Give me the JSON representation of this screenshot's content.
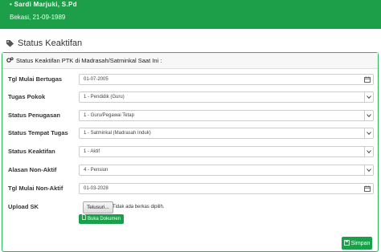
{
  "banner": {
    "name_text": "• Sardi Marjuki, S.Pd",
    "dob_text": "Bekasi, 21-09-1989"
  },
  "page": {
    "section_title": "Status Keaktifan",
    "panel_title": "Status Keaktifan PTK di Madrasah/Satminkal Saat Ini :"
  },
  "form": {
    "tgl_mulai_bertugas": {
      "label": "Tgl Mulai Bertugas",
      "value": "01-07-2005"
    },
    "tugas_pokok": {
      "label": "Tugas Pokok",
      "value": "1 - Pendidik (Guru)"
    },
    "status_penugasan": {
      "label": "Status Penugasan",
      "value": "1 - Guru/Pegawai Tetap"
    },
    "status_tempat_tugas": {
      "label": "Status Tempat Tugas",
      "value": "1 - Satminkal (Madrasah Induk)"
    },
    "status_keaktifan": {
      "label": "Status Keaktifan",
      "value": "1 - Aktif"
    },
    "alasan_non_aktif": {
      "label": "Alasan Non-Aktif",
      "value": "4 - Pensiun"
    },
    "tgl_mulai_non_aktif": {
      "label": "Tgl Mulai Non-Aktif",
      "value": "01-03-2028"
    },
    "upload_sk": {
      "label": "Upload SK",
      "file_button": "Telusuri...",
      "file_status": "Tidak ada berkas dipilih.",
      "doc_button": "Buka Dokumen"
    }
  },
  "actions": {
    "save_label": "Simpan"
  },
  "colors": {
    "accent": "#1a9f4a",
    "banner": "#1c9f48",
    "panel_border": "#2db35a"
  }
}
